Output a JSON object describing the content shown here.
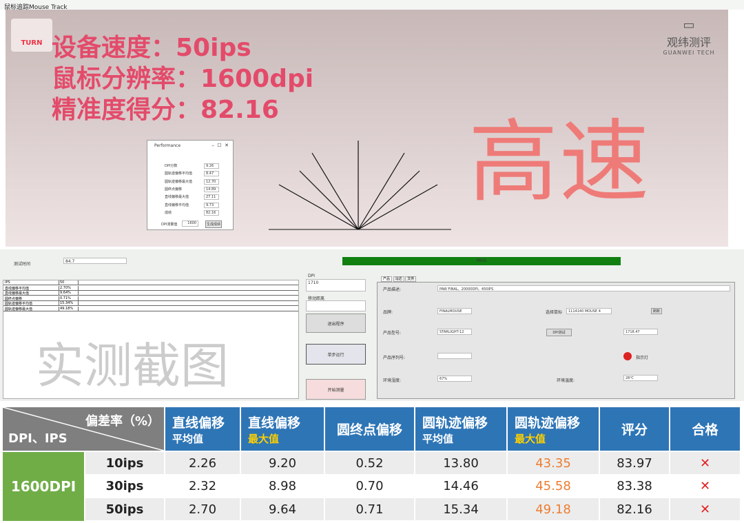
{
  "window_title": "鼠标追踪Mouse Track",
  "overlay": {
    "speed": "设备速度：50ips",
    "dpi": "鼠标分辨率：1600dpi",
    "score": "精准度得分：82.16",
    "speed_word": "高速",
    "logo_left": "TURN",
    "logo_right": "观纬测评",
    "logo_right_en": "GUANWEI TECH",
    "watermark": "实测截图"
  },
  "perf": {
    "title": "Performance",
    "rows": [
      {
        "label": "DPI分数",
        "value": "9.26"
      },
      {
        "label": "圆轨迹偏移平均值",
        "value": "8.47"
      },
      {
        "label": "圆轨迹偏移最大值",
        "value": "12.70"
      },
      {
        "label": "圆终点偏移",
        "value": "14.89"
      },
      {
        "label": "直线偏移最大值",
        "value": "27.11"
      },
      {
        "label": "直线偏移平均值",
        "value": "9.73"
      },
      {
        "label": "成绩",
        "value": "82.16"
      }
    ],
    "dpi_label": "DPI测量值",
    "dpi_value": "1600",
    "gen_button": "生成成绩"
  },
  "form": {
    "time_label": "测试时间",
    "time_value": "84.7",
    "status": "PASS",
    "dpi_label": "DPI",
    "dpi_value": "1710",
    "dist_label": "移动距离",
    "exit": "退出程序",
    "step": "单步运行",
    "start": "开始测量",
    "grid": [
      [
        "IPS",
        "50"
      ],
      [
        "直线偏移平均值",
        "2.70%"
      ],
      [
        "直线偏移最大值",
        "9.64%"
      ],
      [
        "圆终点偏移",
        "0.71%"
      ],
      [
        "圆轨迹偏移平均值",
        "15.34%"
      ],
      [
        "圆轨迹偏移最大值",
        "49.18%"
      ]
    ],
    "tabs": [
      "产品",
      "马达",
      "文件"
    ],
    "desc_label": "产品描述:",
    "desc": "PAW FINAL、20000DPI、450IPS",
    "brand_label": "品牌:",
    "brand": "FINALMOUSE",
    "select_label": "选择鼠标",
    "select": "1114140  MOUSE 4",
    "refresh": "刷新",
    "model_label": "产品型号:",
    "model": "STARLIGHT-12",
    "dpi_test": "DPI测试",
    "dpi_result": "1718.47",
    "serial_label": "产品序列号:",
    "light_label": "指示灯",
    "humid_label": "环境湿度:",
    "humid": "67%",
    "temp_label": "环境温度:",
    "temp": "28℃"
  },
  "table": {
    "corner_top": "偏差率（%）",
    "corner_bottom": "DPI、IPS",
    "headers": [
      {
        "a": "直线偏移",
        "b": "平均值"
      },
      {
        "a": "直线偏移",
        "b": "最大值"
      },
      {
        "a": "圆终点偏移",
        "b": ""
      },
      {
        "a": "圆轨迹偏移",
        "b": "平均值"
      },
      {
        "a": "圆轨迹偏移",
        "b": "最大值"
      },
      {
        "a": "评分",
        "b": ""
      },
      {
        "a": "合格",
        "b": ""
      }
    ],
    "group": "1600DPI",
    "rows": [
      {
        "ips": "10ips",
        "v": [
          "2.26",
          "9.20",
          "0.52",
          "13.80",
          "43.35",
          "83.97",
          "✕"
        ]
      },
      {
        "ips": "30ips",
        "v": [
          "2.32",
          "8.98",
          "0.70",
          "14.46",
          "45.58",
          "83.38",
          "✕"
        ]
      },
      {
        "ips": "50ips",
        "v": [
          "2.70",
          "9.64",
          "0.71",
          "15.34",
          "49.18",
          "82.16",
          "✕"
        ]
      }
    ],
    "colors": {
      "header": "#2e75b6",
      "group": "#70ad47",
      "highlight": "#ed7d31",
      "fail": "#e02020",
      "max_label": "#ffd000"
    }
  }
}
